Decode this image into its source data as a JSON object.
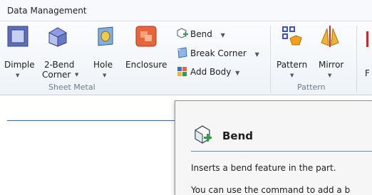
{
  "tab": {
    "label": "Data Management"
  },
  "sheet_metal": {
    "group_label": "Sheet Metal",
    "dimple": "Dimple",
    "two_bend_corner_line1": "2-Bend",
    "two_bend_corner_line2": "Corner",
    "hole": "Hole",
    "enclosure": "Enclosure",
    "bend": "Bend",
    "break_corner": "Break Corner",
    "add_body": "Add Body"
  },
  "pattern_group": {
    "group_label": "Pattern",
    "pattern": "Pattern",
    "mirror": "Mirror",
    "partial": "F"
  },
  "tooltip": {
    "title": "Bend",
    "line1": "Inserts a bend feature in the part.",
    "line2": "You can use the command to add a b"
  },
  "colors": {
    "accent": "#1f6fbf",
    "mirror_red": "#e02020",
    "enclosure_orange": "#e8643c"
  }
}
